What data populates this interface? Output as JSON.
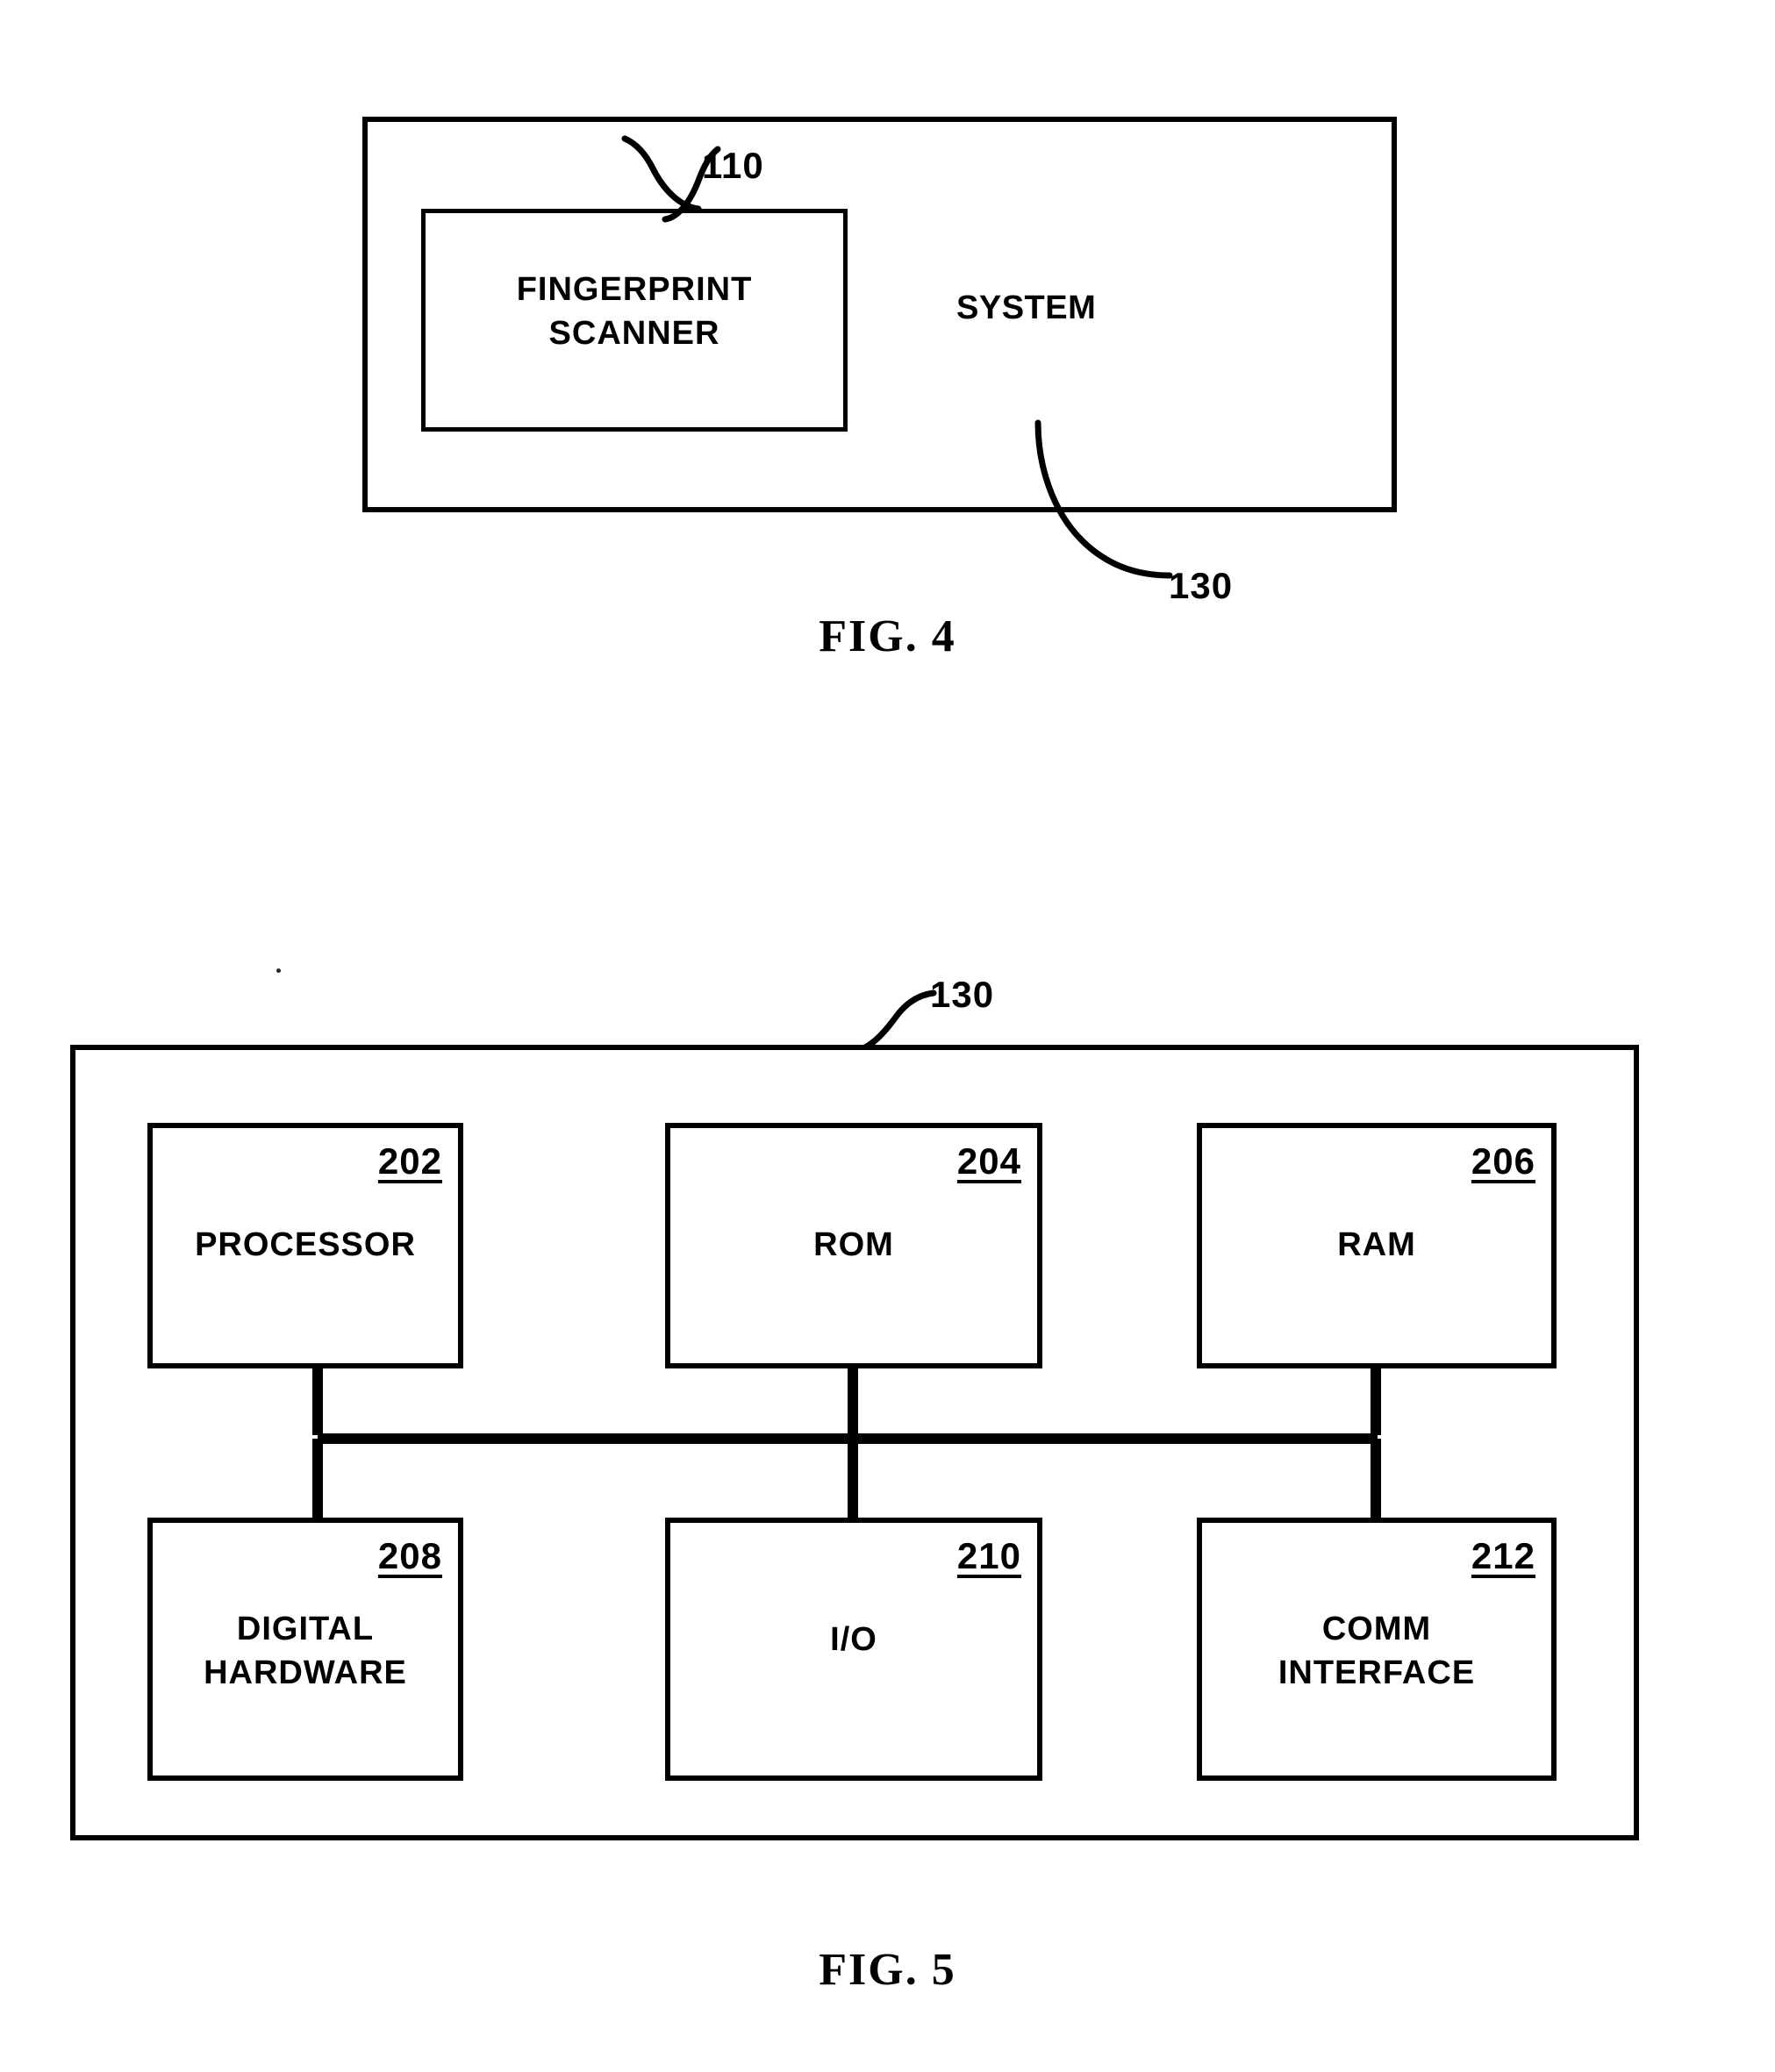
{
  "document": {
    "kind": "patent-figure-sheet",
    "figures": [
      "FIG. 4",
      "FIG. 5"
    ]
  },
  "fig4": {
    "caption": "FIG. 4",
    "system_label": "SYSTEM",
    "system_ref": "130",
    "scanner_ref": "110",
    "scanner_line1": "FINGERPRINT",
    "scanner_line2": "SCANNER"
  },
  "fig5": {
    "caption": "FIG. 5",
    "system_ref": "130",
    "blocks": [
      {
        "ref": "202",
        "line1": "PROCESSOR",
        "line2": "",
        "row": "top"
      },
      {
        "ref": "204",
        "line1": "ROM",
        "line2": "",
        "row": "top"
      },
      {
        "ref": "206",
        "line1": "RAM",
        "line2": "",
        "row": "top"
      },
      {
        "ref": "208",
        "line1": "DIGITAL",
        "line2": "HARDWARE",
        "row": "bottom"
      },
      {
        "ref": "210",
        "line1": "I/O",
        "line2": "",
        "row": "bottom"
      },
      {
        "ref": "212",
        "line1": "COMM",
        "line2": "INTERFACE",
        "row": "bottom"
      }
    ],
    "bus_name": "system-bus"
  },
  "colors": {
    "ink": "#000000",
    "paper": "#ffffff"
  }
}
